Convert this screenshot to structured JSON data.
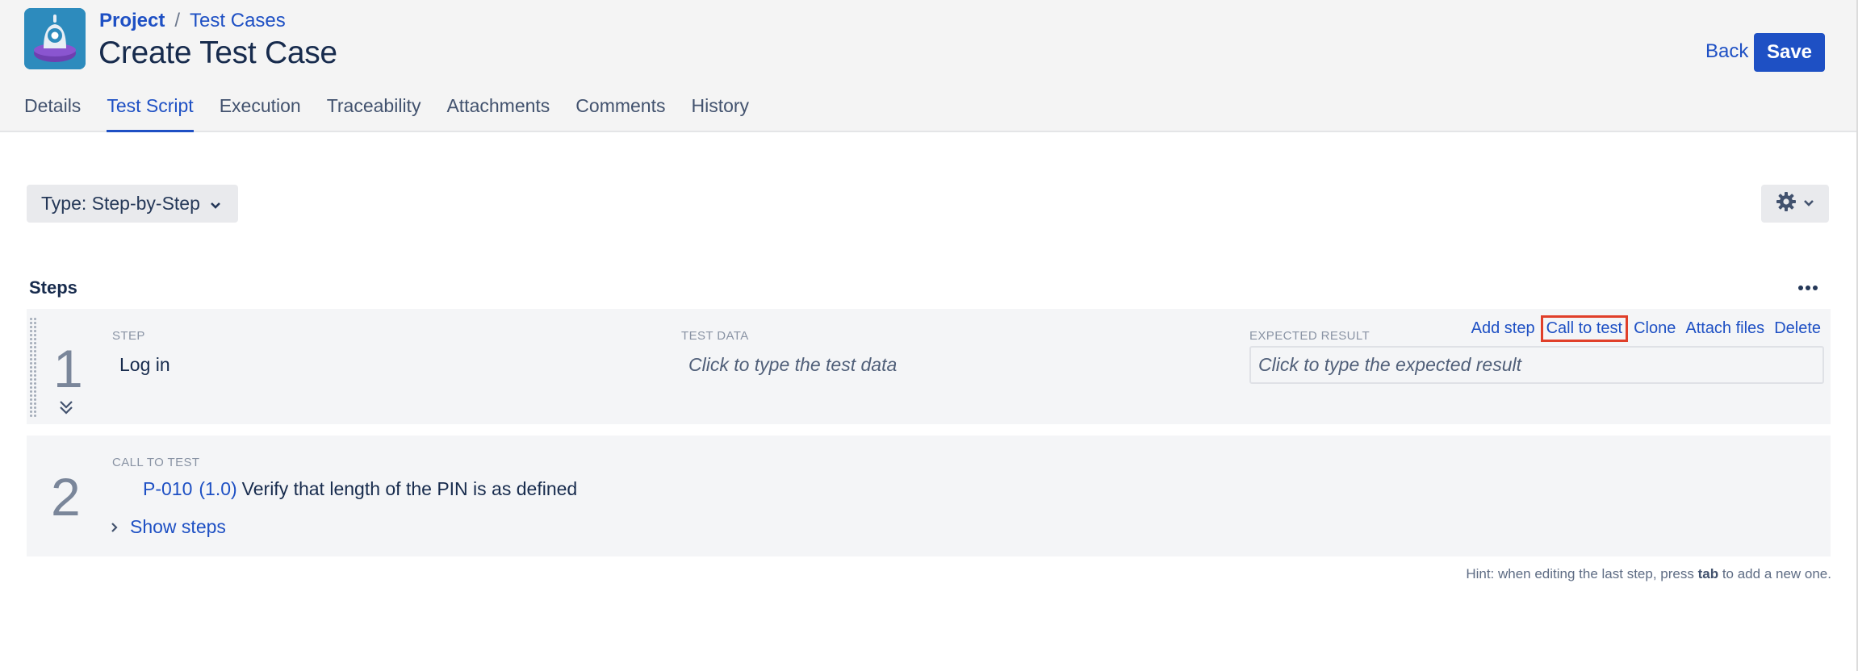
{
  "header": {
    "breadcrumb": {
      "project": "Project",
      "separator": "/",
      "section": "Test Cases"
    },
    "title": "Create Test Case",
    "back_label": "Back",
    "save_label": "Save"
  },
  "tabs": [
    {
      "label": "Details"
    },
    {
      "label": "Test Script",
      "active": true
    },
    {
      "label": "Execution"
    },
    {
      "label": "Traceability"
    },
    {
      "label": "Attachments"
    },
    {
      "label": "Comments"
    },
    {
      "label": "History"
    }
  ],
  "toolbar": {
    "type_label": "Type: Step-by-Step"
  },
  "steps_section": {
    "title": "Steps",
    "steps": [
      {
        "number": "1",
        "step_label": "STEP",
        "step_value": "Log in",
        "test_data_label": "TEST DATA",
        "test_data_placeholder": "Click to type the test data",
        "expected_label": "EXPECTED RESULT",
        "expected_placeholder": "Click to type the expected result",
        "actions": [
          "Add step",
          "Call to test",
          "Clone",
          "Attach files",
          "Delete"
        ]
      },
      {
        "number": "2",
        "label": "CALL TO TEST",
        "test_key": "P-010",
        "test_version": "(1.0)",
        "test_title": "Verify that length of the PIN is as defined",
        "show_steps_label": "Show steps"
      }
    ]
  },
  "hint": {
    "prefix": "Hint: when editing the last step, press",
    "key": "tab",
    "suffix": "to add a new one."
  },
  "colors": {
    "accent": "#1e50c4",
    "highlight": "#e03f2a",
    "row_bg": "#f4f5f7"
  }
}
